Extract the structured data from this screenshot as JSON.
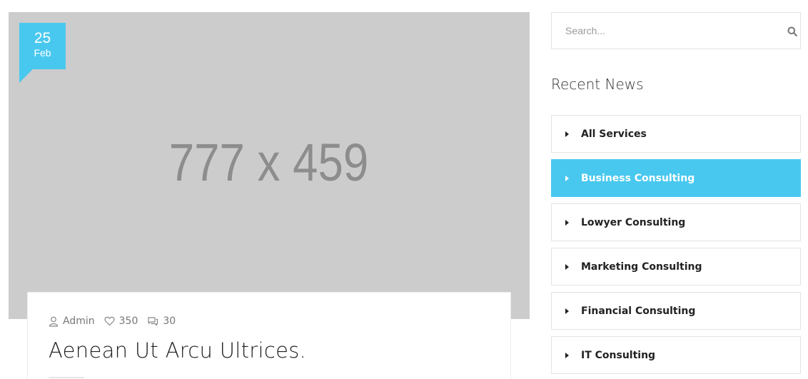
{
  "post": {
    "image_placeholder": "777 x 459",
    "date_day": "25",
    "date_month": "Feb",
    "author": "Admin",
    "likes": "350",
    "comments": "30",
    "title": "Aenean Ut Arcu Ultrices."
  },
  "sidebar": {
    "search_placeholder": "Search...",
    "widget_title": "Recent News",
    "categories": [
      {
        "label": "All Services",
        "active": false
      },
      {
        "label": "Business Consulting",
        "active": true
      },
      {
        "label": "Lowyer Consulting",
        "active": false
      },
      {
        "label": "Marketing Consulting",
        "active": false
      },
      {
        "label": "Financial Consulting",
        "active": false
      },
      {
        "label": "IT Consulting",
        "active": false
      }
    ]
  },
  "colors": {
    "accent": "#49c8ef",
    "image_bg": "#cccccc"
  },
  "icons": {
    "author": "user-icon",
    "likes": "heart-icon",
    "comments": "comments-icon",
    "search": "search-icon",
    "category": "caret-right-icon"
  }
}
